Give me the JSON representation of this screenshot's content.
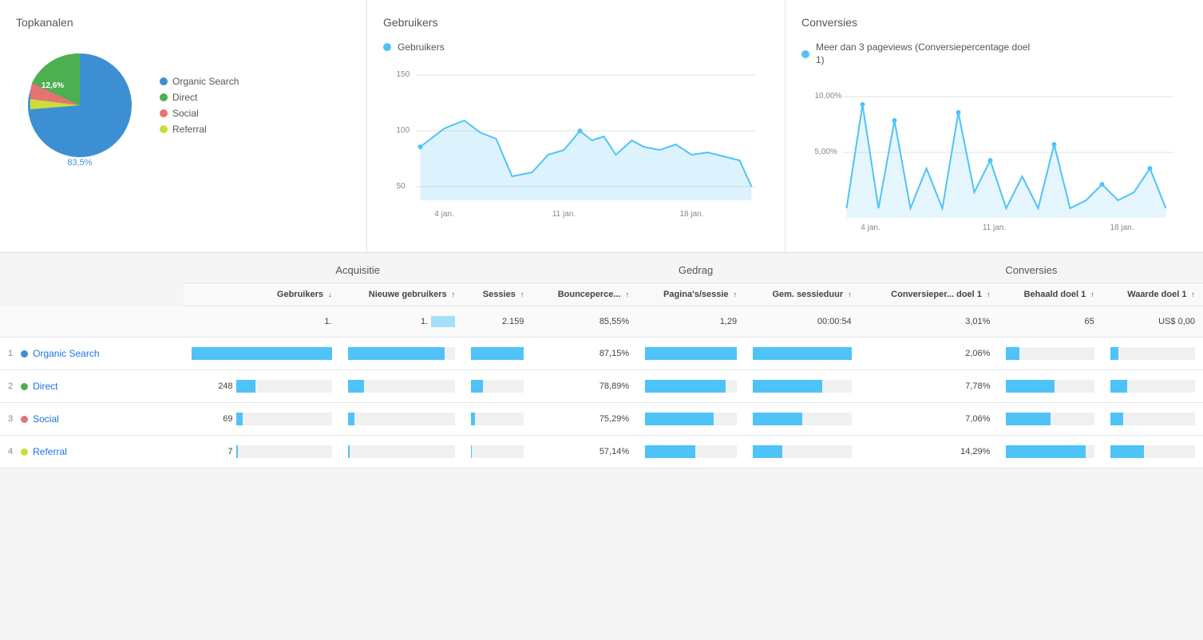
{
  "topkanalen": {
    "title": "Topkanalen",
    "legend": [
      {
        "label": "Organic Search",
        "color": "#3d8fd4",
        "pct": 83.5
      },
      {
        "label": "Direct",
        "color": "#4caf50",
        "pct": 12.6
      },
      {
        "label": "Social",
        "color": "#e57373",
        "pct": 2.5
      },
      {
        "label": "Referral",
        "color": "#ffee58",
        "pct": 1.4
      }
    ],
    "label_large": "83,5%",
    "label_small": "12,6%"
  },
  "gebruikers": {
    "title": "Gebruikers",
    "legend_label": "Gebruikers",
    "y_labels": [
      "150",
      "100",
      "50"
    ],
    "x_labels": [
      "4 jan.",
      "11 jan.",
      "18 jan."
    ]
  },
  "conversies_chart": {
    "title": "Conversies",
    "legend_label": "Meer dan 3 pageviews (Conversiepercentage doel 1)",
    "y_labels": [
      "10,00%",
      "5,00%"
    ],
    "x_labels": [
      "4 jan.",
      "11 jan.",
      "18 jan."
    ]
  },
  "table": {
    "sections": {
      "acquisitie": "Acquisitie",
      "gedrag": "Gedrag",
      "conversies": "Conversies"
    },
    "columns": [
      {
        "label": "Gebruikers",
        "sub": "",
        "sortable": true
      },
      {
        "label": "Nieuwe gebruikers",
        "sub": "",
        "sortable": true
      },
      {
        "label": "Sessies",
        "sub": "",
        "sortable": true
      },
      {
        "label": "Bounceperce...",
        "sub": "",
        "sortable": true
      },
      {
        "label": "Pagina's/sessie",
        "sub": "",
        "sortable": true
      },
      {
        "label": "Gem. sessieduur",
        "sub": "",
        "sortable": true
      },
      {
        "label": "Conversieper... doel 1",
        "sub": "",
        "sortable": true
      },
      {
        "label": "Behaald doel 1",
        "sub": "",
        "sortable": true
      },
      {
        "label": "Waarde doel 1",
        "sub": "",
        "sortable": true
      }
    ],
    "total_row": {
      "gebruikers": "1.",
      "nieuwe_gebruikers": "1.",
      "sessies": "2.159",
      "bounce": "85,55%",
      "paginas": "1,29",
      "gem_sessie": "00:00:54",
      "conv_pct": "3,01%",
      "behaald": "65",
      "waarde": "US$ 0,00"
    },
    "rows": [
      {
        "num": 1,
        "channel": "Organic Search",
        "color": "#3d8fd4",
        "gebruikers": "",
        "gebruikers_bar": 100,
        "nieuwe_gebruikers_bar": 90,
        "sessies": "",
        "bounce": "87,15%",
        "paginas_bar": 100,
        "gem_sessie": "",
        "conv_pct": "2,06%",
        "behaald_bar": 15,
        "waarde": ""
      },
      {
        "num": 2,
        "channel": "Direct",
        "color": "#4caf50",
        "gebruikers": "248",
        "gebruikers_bar": 20,
        "nieuwe_gebruikers_bar": 15,
        "sessies": "",
        "bounce": "78,89%",
        "paginas_bar": 88,
        "gem_sessie": "",
        "conv_pct": "7,78%",
        "behaald_bar": 55,
        "waarde": ""
      },
      {
        "num": 3,
        "channel": "Social",
        "color": "#e57373",
        "gebruikers": "69",
        "gebruikers_bar": 7,
        "nieuwe_gebruikers_bar": 6,
        "sessies": "",
        "bounce": "75,29%",
        "paginas_bar": 75,
        "gem_sessie": "",
        "conv_pct": "7,06%",
        "behaald_bar": 50,
        "waarde": ""
      },
      {
        "num": 4,
        "channel": "Referral",
        "color": "#cddc39",
        "gebruikers": "7",
        "gebruikers_bar": 2,
        "nieuwe_gebruikers_bar": 2,
        "sessies": "",
        "bounce": "57,14%",
        "paginas_bar": 55,
        "gem_sessie": "",
        "conv_pct": "14,29%",
        "behaald_bar": 90,
        "waarde": ""
      }
    ]
  }
}
